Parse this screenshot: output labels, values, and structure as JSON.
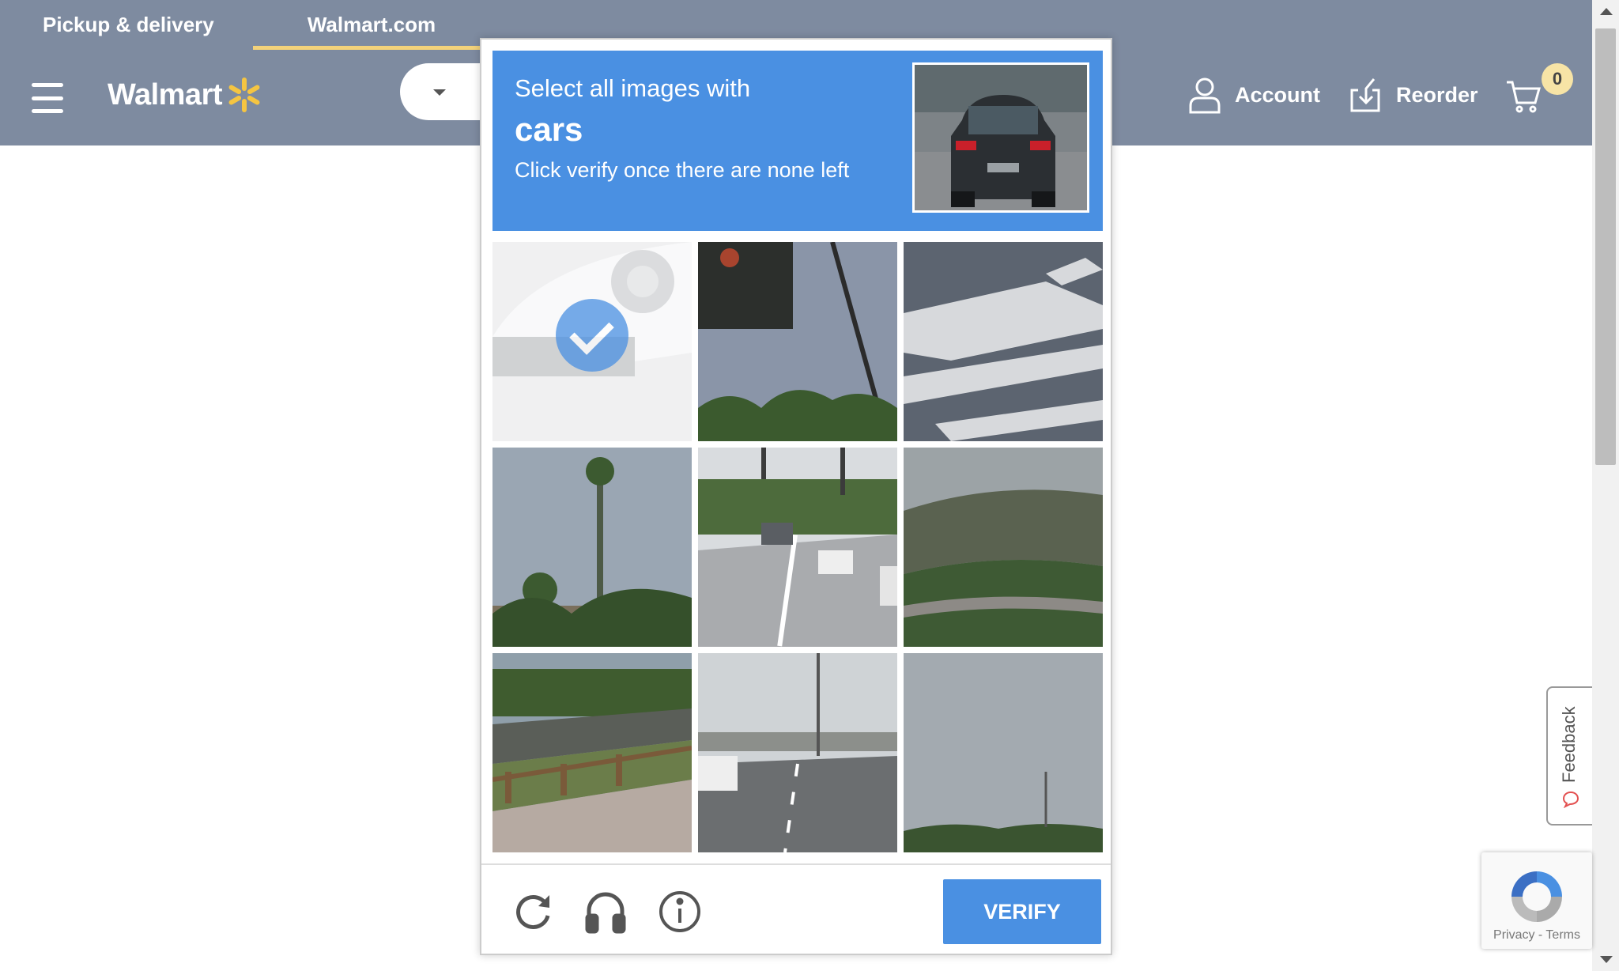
{
  "nav": {
    "pickup_tab": "Pickup & delivery",
    "site_tab": "Walmart.com",
    "logo_text": "Walmart",
    "account_label": "Account",
    "reorder_label": "Reorder",
    "cart_count": "0"
  },
  "captcha": {
    "instruction": "Select all images with",
    "target": "cars",
    "subtext": "Click verify once there are none left",
    "tiles": [
      {
        "index": 1,
        "selected": true
      },
      {
        "index": 2,
        "selected": false
      },
      {
        "index": 3,
        "selected": false
      },
      {
        "index": 4,
        "selected": false
      },
      {
        "index": 5,
        "selected": false
      },
      {
        "index": 6,
        "selected": false
      },
      {
        "index": 7,
        "selected": false
      },
      {
        "index": 8,
        "selected": false
      },
      {
        "index": 9,
        "selected": false
      }
    ],
    "verify_label": "VERIFY",
    "footer_icons": [
      "reload-icon",
      "headphones-icon",
      "info-icon"
    ]
  },
  "feedback": {
    "label": "Feedback"
  },
  "recaptcha_badge": {
    "links": "Privacy - Terms"
  },
  "colors": {
    "header_bg": "#7e8ba0",
    "captcha_blue": "#4a90e2",
    "spark_yellow": "#f5c542"
  }
}
